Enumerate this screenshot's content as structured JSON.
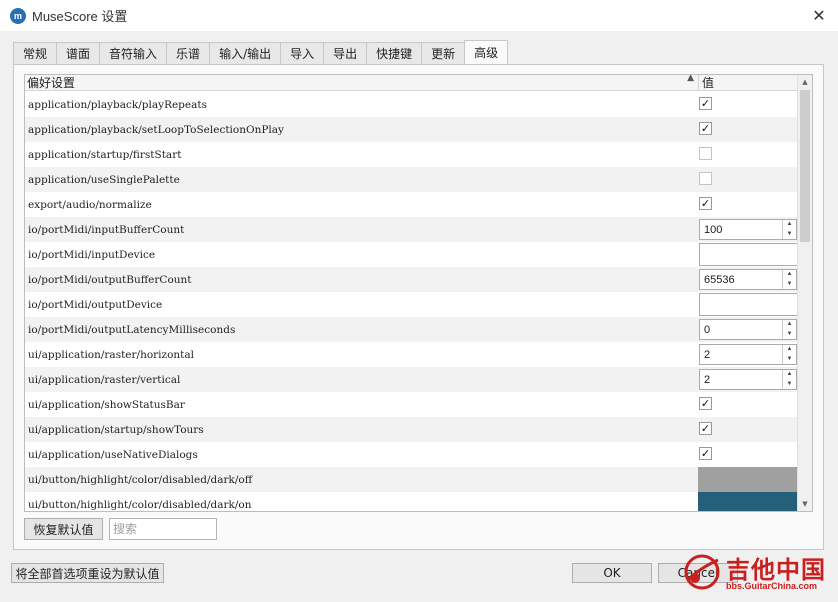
{
  "window": {
    "title": "MuseScore 设置",
    "icon": "musescore-logo",
    "close_glyph": "✕"
  },
  "tabs": [
    {
      "label": "常规",
      "active": false
    },
    {
      "label": "谱面",
      "active": false
    },
    {
      "label": "音符输入",
      "active": false
    },
    {
      "label": "乐谱",
      "active": false
    },
    {
      "label": "输入/输出",
      "active": false
    },
    {
      "label": "导入",
      "active": false
    },
    {
      "label": "导出",
      "active": false
    },
    {
      "label": "快捷键",
      "active": false
    },
    {
      "label": "更新",
      "active": false
    },
    {
      "label": "高级",
      "active": true
    }
  ],
  "table": {
    "col_key": "偏好设置",
    "col_value": "值",
    "sort_indicator": "▲",
    "rows": [
      {
        "key": "application/playback/playRepeats",
        "type": "checkbox",
        "checked": true
      },
      {
        "key": "application/playback/setLoopToSelectionOnPlay",
        "type": "checkbox",
        "checked": true
      },
      {
        "key": "application/startup/firstStart",
        "type": "checkbox",
        "checked": false
      },
      {
        "key": "application/useSinglePalette",
        "type": "checkbox",
        "checked": false
      },
      {
        "key": "export/audio/normalize",
        "type": "checkbox",
        "checked": true
      },
      {
        "key": "io/portMidi/inputBufferCount",
        "type": "spin",
        "value": "100"
      },
      {
        "key": "io/portMidi/inputDevice",
        "type": "text",
        "value": ""
      },
      {
        "key": "io/portMidi/outputBufferCount",
        "type": "spin",
        "value": "65536"
      },
      {
        "key": "io/portMidi/outputDevice",
        "type": "text",
        "value": ""
      },
      {
        "key": "io/portMidi/outputLatencyMilliseconds",
        "type": "spin",
        "value": "0"
      },
      {
        "key": "ui/application/raster/horizontal",
        "type": "spin",
        "value": "2"
      },
      {
        "key": "ui/application/raster/vertical",
        "type": "spin",
        "value": "2"
      },
      {
        "key": "ui/application/showStatusBar",
        "type": "checkbox",
        "checked": true
      },
      {
        "key": "ui/application/startup/showTours",
        "type": "checkbox",
        "checked": true
      },
      {
        "key": "ui/application/useNativeDialogs",
        "type": "checkbox",
        "checked": true
      },
      {
        "key": "ui/button/highlight/color/disabled/dark/off",
        "type": "color",
        "color": "#a0a0a0"
      },
      {
        "key": "ui/button/highlight/color/disabled/dark/on",
        "type": "color",
        "color": "#24607a"
      }
    ]
  },
  "buttons": {
    "reset_default": "恢复默认值",
    "search_placeholder": "搜索",
    "reset_all": "将全部首选项重设为默认值",
    "ok": "OK",
    "cancel": "Cancel"
  },
  "watermark": {
    "text": "吉他中国",
    "url": "bbs.GuitarChina.com"
  },
  "colors": {
    "accent_dark": "#24607a",
    "swatch_gray": "#a0a0a0",
    "watermark_red": "#c9201f"
  }
}
